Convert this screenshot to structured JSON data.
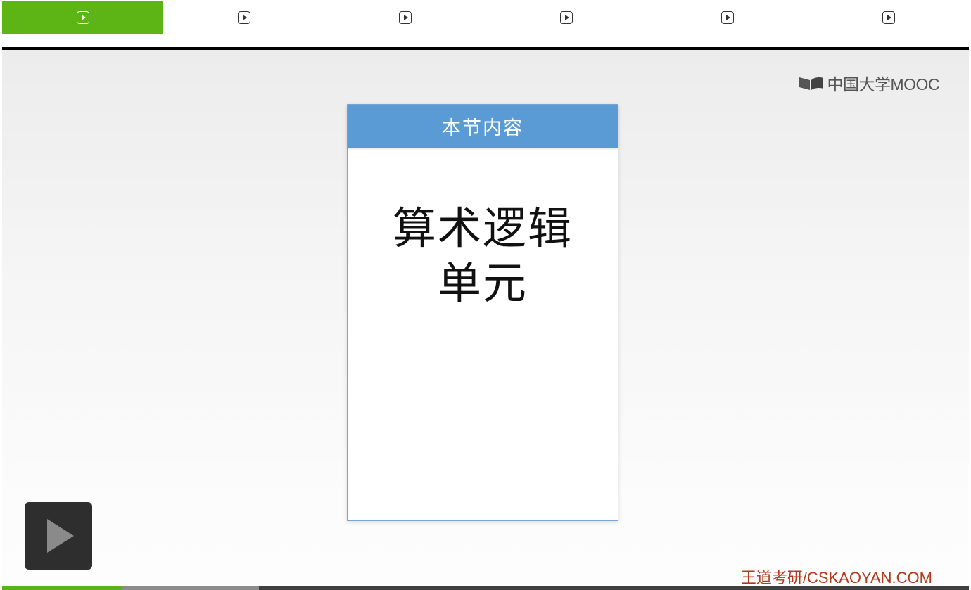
{
  "tabs": [
    {
      "icon": "play-square-icon",
      "active": true
    },
    {
      "icon": "play-square-icon",
      "active": false
    },
    {
      "icon": "play-square-icon",
      "active": false
    },
    {
      "icon": "play-square-icon",
      "active": false
    },
    {
      "icon": "play-square-icon",
      "active": false
    },
    {
      "icon": "play-square-icon",
      "active": false
    }
  ],
  "watermark": {
    "text": "中国大学MOOC",
    "icon": "book-logo-icon"
  },
  "slide": {
    "header": "本节内容",
    "title_line1": "算术逻辑",
    "title_line2": "单元"
  },
  "player": {
    "play_icon": "play-icon",
    "progress_played": 0.124,
    "progress_buffered": 0.266
  },
  "credit": "王道考研/CSKAOYAN.COM",
  "colors": {
    "active_tab": "#5cb514",
    "slide_header": "#5b9bd5",
    "credit": "#b23a1a",
    "progress_played": "#56b41a"
  }
}
